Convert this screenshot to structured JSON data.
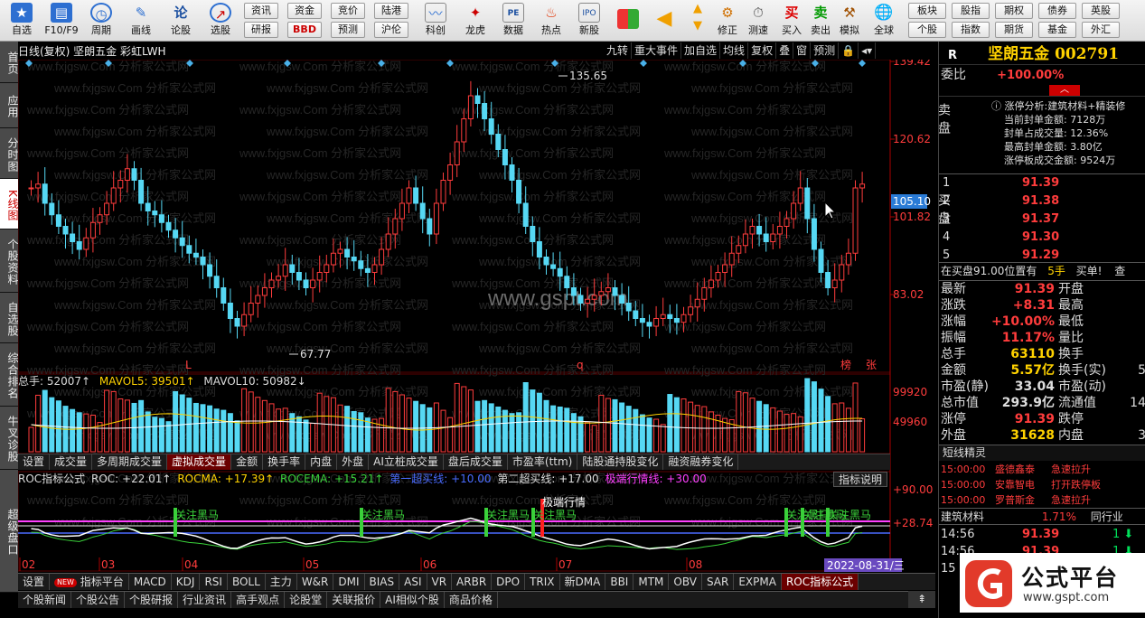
{
  "toolbar": {
    "buttons": [
      {
        "label": "自选",
        "icon": "star-icon"
      },
      {
        "label": "F10/F9",
        "icon": "list-icon"
      },
      {
        "label": "周期",
        "icon": "clock-icon"
      },
      {
        "label": "画线",
        "icon": "pencil-icon"
      },
      {
        "label": "论股",
        "icon": "discuss-icon"
      },
      {
        "label": "选股",
        "icon": "search-chart-icon"
      }
    ],
    "pills_row1": [
      "资讯",
      "资金",
      "竞价",
      "陆港"
    ],
    "pills_row2": [
      "研报",
      "BBD",
      "预测",
      "沪伦"
    ],
    "buttons2": [
      {
        "label": "科创"
      },
      {
        "label": "龙虎"
      },
      {
        "label": "数据"
      },
      {
        "label": "热点"
      },
      {
        "label": "新股"
      }
    ],
    "small_buttons": [
      {
        "label": "修正"
      },
      {
        "label": "测速"
      },
      {
        "label": "买入"
      },
      {
        "label": "卖出"
      },
      {
        "label": "模拟"
      },
      {
        "label": "全球"
      }
    ],
    "right_pills_row1": [
      "板块",
      "股指",
      "期权",
      "债券",
      "英股"
    ],
    "right_pills_row2": [
      "个股",
      "指数",
      "期货",
      "基金",
      "外汇"
    ]
  },
  "left_tabs": [
    "首页",
    "应用",
    "分时图",
    "K线图",
    "个股资料",
    "自选股",
    "综合排名",
    "牛叉诊股",
    "超级盘口"
  ],
  "chart_header": {
    "title": "日线(复权)  坚朗五金 彩虹LWH",
    "buttons": [
      "九转",
      "重大事件",
      "加自选",
      "均线",
      "复权",
      "叠",
      "窗",
      "预测"
    ]
  },
  "watermark": {
    "site": "www.fxjgsw.Com 分析家公式网",
    "center": "www.gspt.com"
  },
  "price_axis": {
    "labels": [
      "139.42",
      "120.62",
      "101.82",
      "83.02"
    ],
    "current_tag": "105.10",
    "high_label": "135.65",
    "low_label": "67.77",
    "markers": [
      "L",
      "q",
      "榜",
      "张"
    ]
  },
  "volume": {
    "header": {
      "total": "总手: 52007↑",
      "mavol5": "MAVOL5: 39501↑",
      "mavol10": "MAVOL10: 50982↓"
    },
    "axis": [
      "99920",
      "49960"
    ],
    "tabs": [
      "设置",
      "成交量",
      "多周期成交量",
      "虚拟成交量",
      "金额",
      "换手率",
      "内盘",
      "外盘",
      "AI立桩成交量",
      "盘后成交量",
      "市盈率(ttm)",
      "陆股通持股变化",
      "融资融券变化"
    ],
    "active_tab": "虚拟成交量"
  },
  "roc": {
    "header": {
      "name": "ROC指标公式",
      "roc": "ROC: +22.01↑",
      "rocma": "ROCMA: +17.39↑",
      "rocema": "ROCEMA: +15.21↑",
      "buy1": "第一超买线: +10.00",
      "buy2": "第二超买线: +17.00",
      "extreme": "极端行情线: +30.00"
    },
    "explain_button": "指标说明",
    "axis": [
      "+90.00",
      "+28.74"
    ],
    "annotations": [
      "关注黑马",
      "关注黑马",
      "关注黑马",
      "关注黑马",
      "极端行情",
      "关注黑马",
      "关注黑马",
      "关注黑马"
    ],
    "months": [
      "02",
      "03",
      "04",
      "05",
      "06",
      "07",
      "08"
    ],
    "date_tag": "2022-08-31/三"
  },
  "indicator_tabs": [
    "设置",
    "指标平台",
    "MACD",
    "KDJ",
    "RSI",
    "BOLL",
    "主力",
    "W&R",
    "DMI",
    "BIAS",
    "ASI",
    "VR",
    "ARBR",
    "DPO",
    "TRIX",
    "新DMA",
    "BBI",
    "MTM",
    "OBV",
    "SAR",
    "EXPMA",
    "ROC指标公式"
  ],
  "indicator_active": "ROC指标公式",
  "new_badge": "NEW",
  "nav_tabs": [
    "个股新闻",
    "个股公告",
    "个股研报",
    "行业资讯",
    "高手观点",
    "论股堂",
    "关联报价",
    "AI相似个股",
    "商品价格"
  ],
  "right_panel": {
    "code_prefix": "R",
    "title": "坚朗五金 002791",
    "weibi_label": "委比",
    "weibi_value": "+100.00%",
    "sell_label": "卖盘",
    "limit_info": {
      "title": "涨停分析:建筑材料+精装修",
      "lines": [
        "当前封单金额: 7128万",
        "封单占成交量: 12.36%",
        "最高封单金额: 3.80亿",
        "涨停板成交金额: 9524万"
      ]
    },
    "buy_label": "买盘",
    "bids": [
      {
        "level": "1",
        "price": "91.39"
      },
      {
        "level": "2",
        "price": "91.38"
      },
      {
        "level": "3",
        "price": "91.37"
      },
      {
        "level": "4",
        "price": "91.30"
      },
      {
        "level": "5",
        "price": "91.29"
      }
    ],
    "position_line": {
      "text": "在买盘91.00位置有",
      "qty": "5手",
      "action": "买单!",
      "more": "查"
    },
    "stats_left": [
      {
        "label": "最新",
        "value": "91.39"
      },
      {
        "label": "涨跌",
        "value": "+8.31"
      },
      {
        "label": "涨幅",
        "value": "+10.00%"
      },
      {
        "label": "振幅",
        "value": "11.17%"
      },
      {
        "label": "总手",
        "value": "63110"
      },
      {
        "label": "金额",
        "value": "5.57亿"
      },
      {
        "label": "市盈(静)",
        "value": "33.04"
      },
      {
        "label": "总市值",
        "value": "293.9亿"
      },
      {
        "label": "涨停",
        "value": "91.39"
      },
      {
        "label": "外盘",
        "value": "31628"
      }
    ],
    "stats_right": [
      "开盘",
      "最高",
      "最低",
      "量比",
      "换手",
      "换手(实)",
      "市盈(动)",
      "流通值",
      "跌停",
      "内盘"
    ],
    "stats_right_partial": [
      "",
      "",
      "",
      "",
      "",
      "5",
      "",
      "14",
      "",
      "3"
    ],
    "short_title": "短线精灵",
    "short_items": [
      {
        "time": "15:00:00",
        "name": "盛德鑫泰",
        "event": "急速拉升"
      },
      {
        "time": "15:00:00",
        "name": "安靠智电",
        "event": "打开跌停板"
      },
      {
        "time": "15:00:00",
        "name": "罗普斯金",
        "event": "急速拉升"
      }
    ],
    "sector": {
      "name": "建筑材料",
      "change": "1.71%",
      "label": "同行业"
    },
    "ticks": [
      {
        "time": "14:56",
        "price": "91.39",
        "vol": "1"
      },
      {
        "time": "14:56",
        "price": "91.39",
        "vol": "1"
      },
      {
        "time": "15",
        "price": "",
        "vol": ""
      }
    ]
  },
  "logo": {
    "name": "公式平台",
    "url": "www.gspt.com"
  }
}
